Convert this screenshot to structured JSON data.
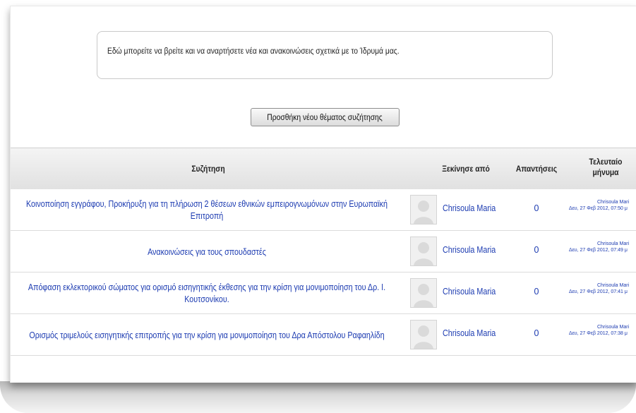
{
  "intro": {
    "text": "Εδώ μπορείτε να βρείτε και να αναρτήσετε νέα και ανακοινώσεις σχετικά με το Ίδρυμά μας."
  },
  "add_button_label": "Προσθήκη νέου θέματος συζήτησης",
  "table": {
    "headers": {
      "discussion": "Συζήτηση",
      "started_by": "Ξεκίνησε από",
      "replies": "Απαντήσεις",
      "last_post_line1": "Τελευταίο",
      "last_post_line2": "μήνυμα"
    },
    "rows": [
      {
        "subject": "Κοινοποίηση εγγράφου, Προκήρυξη για τη πλήρωση 2 θέσεων εθνικών εμπειρογνωμόνων στην Ευρωπαϊκή Επιτροπή",
        "starter": "Chrisoula Maria",
        "replies": "0",
        "last_who": "Chrisoula Mari",
        "last_when": "Δευ, 27 Φεβ 2012, 07:50 μ"
      },
      {
        "subject": "Ανακοινώσεις για τους σπουδαστές",
        "starter": "Chrisoula Maria",
        "replies": "0",
        "last_who": "Chrisoula Mari",
        "last_when": "Δευ, 27 Φεβ 2012, 07:49 μ"
      },
      {
        "subject": "Απόφαση εκλεκτορικού σώματος για ορισμό εισηγητικής έκθεσης για την κρίση για μονιμοποίηση του Δρ. Ι. Κουτσονίκου.",
        "starter": "Chrisoula Maria",
        "replies": "0",
        "last_who": "Chrisoula Mari",
        "last_when": "Δευ, 27 Φεβ 2012, 07:41 μ"
      },
      {
        "subject": "Ορισμός τριμελούς εισηγητικής επιτροπής για την κρίση για μονιμοποίηση του Δρα Απόστολου Ραφαηλίδη",
        "starter": "Chrisoula Maria",
        "replies": "0",
        "last_who": "Chrisoula Mari",
        "last_when": "Δευ, 27 Φεβ 2012, 07:38 μ"
      }
    ]
  },
  "colors": {
    "link": "#1c3bb1",
    "header_bg": "#e6e6e6"
  }
}
